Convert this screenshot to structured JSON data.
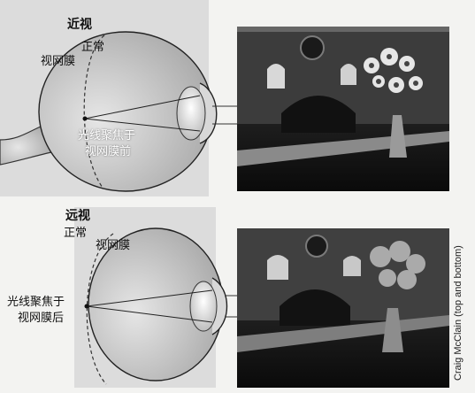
{
  "near": {
    "title": "近视",
    "normal_label": "正常",
    "retina_label": "视网膜",
    "focus_line1": "光线聚焦于",
    "focus_line2": "视网膜前"
  },
  "far": {
    "title": "远视",
    "normal_label": "正常",
    "retina_label": "视网膜",
    "focus_line1": "光线聚焦于",
    "focus_line2": "视网膜后"
  },
  "credit": "Craig McClain (top and bottom)"
}
